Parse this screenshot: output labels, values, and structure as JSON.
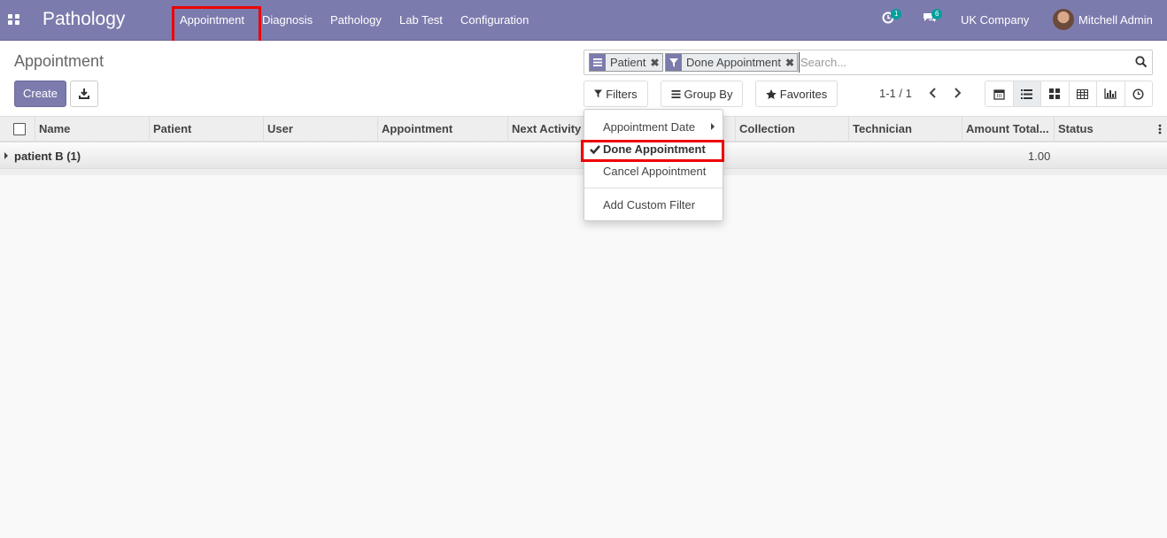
{
  "navbar": {
    "brand": "Pathology",
    "menu": [
      "Appointment",
      "Diagnosis",
      "Pathology",
      "Lab Test",
      "Configuration"
    ],
    "activity_count": "1",
    "message_count": "6",
    "company": "UK Company",
    "user": "Mitchell Admin"
  },
  "control": {
    "breadcrumb": "Appointment",
    "create_label": "Create",
    "search": {
      "facets": [
        {
          "icon": "group-by-icon",
          "label": "Patient"
        },
        {
          "icon": "filter-icon",
          "label": "Done Appointment"
        }
      ],
      "placeholder": "Search..."
    },
    "filters_label": "Filters",
    "groupby_label": "Group By",
    "favorites_label": "Favorites",
    "pager": "1-1 / 1",
    "views": [
      "calendar-view-icon",
      "list-view-icon",
      "kanban-view-icon",
      "pivot-view-icon",
      "graph-view-icon",
      "activity-view-icon"
    ],
    "active_view": "list-view-icon"
  },
  "filters_dropdown": {
    "items": [
      "Appointment Date",
      "Done Appointment",
      "Cancel Appointment",
      "Add Custom Filter"
    ],
    "selected": "Done Appointment"
  },
  "table": {
    "columns": [
      "Name",
      "Patient",
      "User",
      "Appointment",
      "Next Activity",
      "Collection",
      "Technician",
      "Amount Total...",
      "Status"
    ],
    "groups": [
      {
        "label": "patient B (1)",
        "amount": "1.00"
      }
    ]
  },
  "colors": {
    "brand": "#7c7bad",
    "badge": "#00a09d",
    "highlight": "#e00000"
  }
}
